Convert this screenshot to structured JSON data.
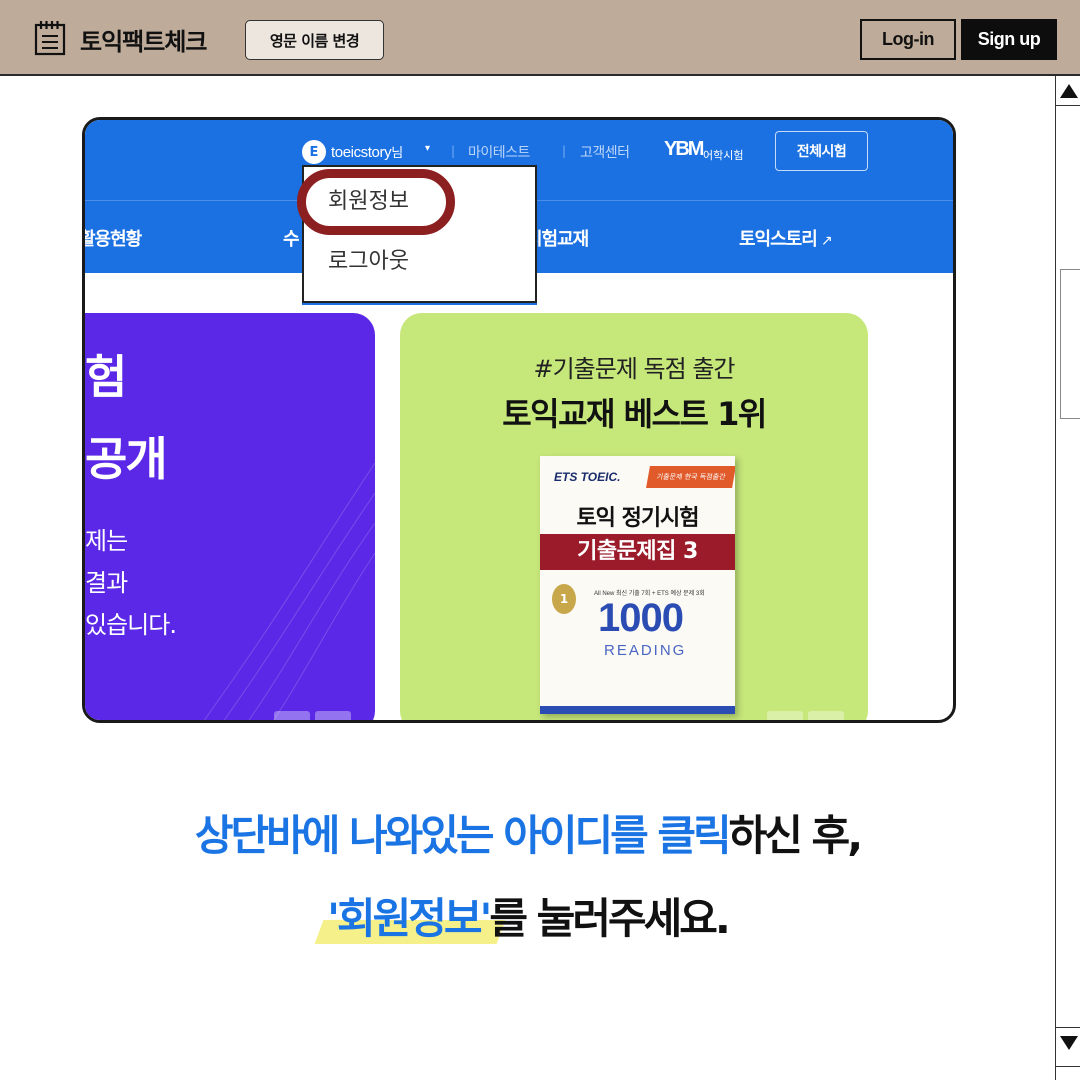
{
  "appbar": {
    "title": "토익팩트체크",
    "logo_icon": "notepad-icon",
    "name_change_button": "영문 이름 변경",
    "login_button": "Log-in",
    "signup_button": "Sign up"
  },
  "screenshot": {
    "user": {
      "avatar_letter": "E",
      "name": "toeicstory",
      "suffix": "님",
      "caret": "▾"
    },
    "util_links": [
      "마이테스트",
      "고객센터"
    ],
    "ybm_logo": "YBM",
    "ybm_text": "어학시험",
    "all_tests_button": "전체시험",
    "nav": [
      "활용현황",
      "수",
      "시험교재",
      "토익스토리"
    ],
    "nav_external_icon": "↗",
    "dropdown": {
      "items": [
        "회원정보",
        "로그아웃"
      ],
      "highlighted": "회원정보"
    },
    "left_slide": {
      "lines": [
        "험",
        "공개"
      ],
      "small_lines": [
        "제는",
        "결과",
        "있습니다."
      ]
    },
    "promo": {
      "subtitle": "#기출문제 독점 출간",
      "title": "토익교재 베스트 1위",
      "book": {
        "brand": "ETS TOEIC.",
        "ribbon": "기출문제 한국 독점출간",
        "title_line1": "토익 정기시험",
        "title_line2": "기출문제집 3",
        "tagline": "All New 최신 기출 7회 + ETS 예상 문제 3회",
        "medal": "1",
        "number": "1000",
        "subject": "READING"
      }
    }
  },
  "caption": {
    "line1_blue": "상단바에 나와있는 아이디를 클릭",
    "line1_black": "하신 후,",
    "line2_highlight": "'회원정보'",
    "line2_black": "를 눌러주세요."
  },
  "colors": {
    "appbar_bg": "#bfab99",
    "site_blue": "#1b71e2",
    "highlight_ring": "#8c1f1f",
    "purple_slide": "#5a28e6",
    "green_slide": "#c6e77a",
    "caption_blue": "#1a74e4",
    "caption_highlight": "#f6f08a"
  }
}
